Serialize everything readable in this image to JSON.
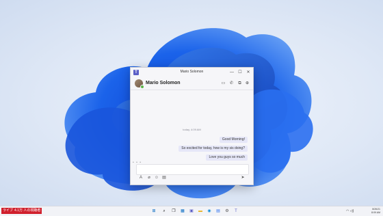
{
  "window": {
    "title": "Mario Solomon",
    "controls": {
      "minimize": "—",
      "maximize": "☐",
      "close": "✕"
    }
  },
  "chat_header": {
    "contact_name": "Mario Solomon",
    "presence": "available",
    "icons": [
      "video-call-icon",
      "phone-call-icon",
      "screen-share-icon",
      "add-people-icon"
    ]
  },
  "conversation": {
    "timestamp": "today, 4:09 AM",
    "messages": [
      {
        "text": "Good Morning!"
      },
      {
        "text": "So excited for today, how is my sis doing?"
      },
      {
        "text": "Love you guys so much"
      }
    ],
    "typing_indicator": "• • •"
  },
  "compose": {
    "toolbar_icons": [
      "format-icon",
      "attach-icon",
      "emoji-icon",
      "gif-icon"
    ],
    "send_icon": "send-icon"
  },
  "taskbar": {
    "ticker_label": "ライブ",
    "ticker_text": "4.1万 人の視聴者",
    "apps": [
      "start-icon",
      "search-icon",
      "task-view-icon",
      "widgets-icon",
      "chat-icon",
      "file-explorer-icon",
      "edge-icon",
      "store-icon",
      "settings-icon",
      "teams-icon"
    ],
    "clock_time": "8/26/21",
    "clock_date": "8:09 AM",
    "accent": "#0067c0"
  },
  "colors": {
    "teams_purple": "#5b5fc7",
    "bubble": "#e6e7f8",
    "presence_green": "#5bb54a"
  }
}
